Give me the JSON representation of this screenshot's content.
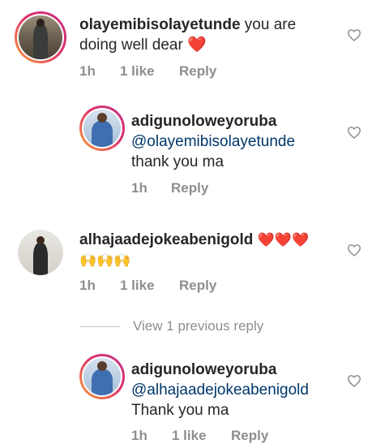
{
  "comments": [
    {
      "username": "olayemibisolayetunde",
      "text": " you  are",
      "text_line2": "doing well dear ",
      "emoji": "❤️",
      "time": "1h",
      "likes": "1 like",
      "reply": "Reply"
    },
    {
      "username": "adigunoloweyoruba",
      "mention": "@olayemibisolayetunde",
      "text": "thank you ma",
      "time": "1h",
      "reply": "Reply"
    },
    {
      "username": "alhajaadejokeabenigold",
      "emoji_hearts": "❤️❤️❤️",
      "emoji_hands": "🙌🙌🙌",
      "time": "1h",
      "likes": "1 like",
      "reply": "Reply"
    },
    {
      "username": "adigunoloweyoruba",
      "mention": "@alhajaadejokeabenigold",
      "text": "Thank you ma",
      "time": "1h",
      "likes": "1 like",
      "reply": "Reply"
    }
  ],
  "view_previous": "View 1 previous reply",
  "colors": {
    "mention": "#00376b",
    "meta": "#8e8e8e",
    "text": "#262626",
    "heart_emoji": "#e0245e"
  }
}
